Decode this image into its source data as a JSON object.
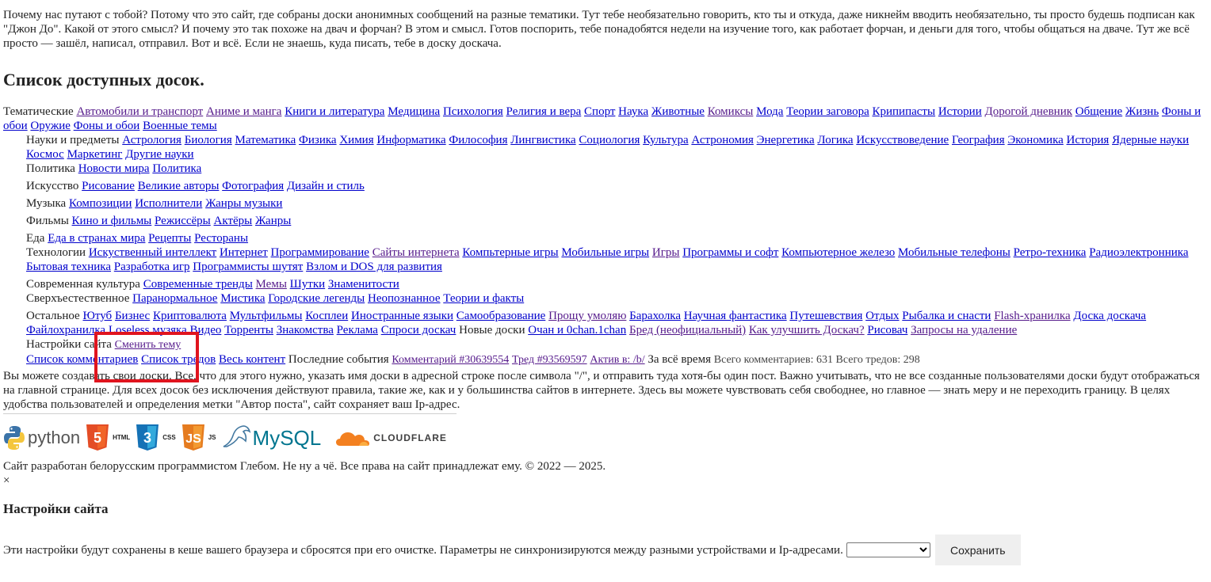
{
  "intro": "Почему нас путают с тобой? Потому что это сайт, где собраны доски анонимных сообщений на разные тематики. Тут тебе необязательно говорить, кто ты и откуда, даже никнейм вводить необязательно, ты просто будешь подписан как \"Джон До\". Какой от этого смысл? И почему это так похоже на двач и форчан? В этом и смысл. Готов поспорить, тебе понадобятся недели на изучение того, как работает форчан, и деньги для того, чтобы общаться на дваче. Тут же всё просто — зашёл, написал, отправил. Вот и всё. Если не знаешь, куда писать, тебе в доску доскача.",
  "boards_title": "Список доступных досок.",
  "categories": {
    "thematic": {
      "label": "Тематические",
      "links": [
        "Автомобили и транспорт",
        "Аниме и манга",
        "Книги и литература",
        "Медицина",
        "Психология",
        "Религия и вера",
        "Спорт",
        "Наука",
        "Животные",
        "Комиксы",
        "Мода",
        "Теории заговора",
        "Крипипасты",
        "Истории",
        "Дорогой дневник",
        "Общение",
        "Жизнь",
        "Фоны и обои",
        "Оружие",
        "Фоны и обои",
        "Военные темы"
      ]
    },
    "science": {
      "label": "Науки и предметы",
      "links": [
        "Астрология",
        "Биология",
        "Математика",
        "Физика",
        "Химия",
        "Информатика",
        "Философия",
        "Лингвистика",
        "Социология",
        "Культура",
        "Астрономия",
        "Энергетика",
        "Логика",
        "Искусствоведение",
        "География",
        "Экономика",
        "История",
        "Ядерные науки",
        "Космос",
        "Маркетинг",
        "Другие науки"
      ]
    },
    "politics": {
      "label": "Политика",
      "links": [
        "Новости мира",
        "Политика"
      ]
    },
    "art": {
      "label": "Искусство",
      "links": [
        "Рисование",
        "Великие авторы",
        "Фотография",
        "Дизайн и стиль"
      ]
    },
    "music": {
      "label": "Музыка",
      "links": [
        "Композиции",
        "Исполнители",
        "Жанры музыки"
      ]
    },
    "films": {
      "label": "Фильмы",
      "links": [
        "Кино и фильмы",
        "Режиссёры",
        "Актёры",
        "Жанры"
      ]
    },
    "food": {
      "label": "Еда",
      "links": [
        "Еда в странах мира",
        "Рецепты",
        "Рестораны"
      ]
    },
    "tech": {
      "label": "Технологии",
      "links": [
        "Искуственный интеллект",
        "Интернет",
        "Программирование",
        "Сайты интернета",
        "Компьтерные игры",
        "Мобильные игры",
        "Игры",
        "Программы и софт",
        "Компьютерное железо",
        "Мобильные телефоны",
        "Ретро-техника",
        "Радиоэлектронника",
        "Бытовая техника",
        "Разработка игр",
        "Программисты шутят",
        "Взлом и DOS для развития"
      ]
    },
    "culture": {
      "label": "Современная культура",
      "links": [
        "Современные тренды",
        "Мемы",
        "Шутки",
        "Знаменитости"
      ]
    },
    "supernatural": {
      "label": "Сверхъестественное",
      "links": [
        "Паранормальное",
        "Мистика",
        "Городские легенды",
        "Неопознанное",
        "Теории и факты"
      ]
    },
    "other": {
      "label": "Остальное",
      "links": [
        "Ютуб",
        "Бизнес",
        "Криптовалюта",
        "Мультфильмы",
        "Косплеи",
        "Иностранные языки",
        "Самообразование",
        "Прощу умоляю",
        "Барахолка",
        "Научная фантастика",
        "Путешевствия",
        "Отдых",
        "Рыбалка и снасти",
        "Flash-хранилка",
        "Доска доскача",
        "Файлохранилка",
        "Loseless музяка",
        "Видео",
        "Торренты",
        "Знакомства",
        "Реклама",
        "Спроси доскач"
      ]
    },
    "new_boards": {
      "label": "Новые доски",
      "links": [
        "Очан и 0chan.1chan",
        "Бред (неофициальный)",
        "Как улучшить Доскач?",
        "Рисовач",
        "Запросы на удаление"
      ]
    },
    "site_settings": {
      "label": "Настройки сайта",
      "link": "Сменить тему"
    },
    "content": {
      "links": [
        "Список комментариев",
        "Список тредов",
        "Весь контент"
      ]
    },
    "recent": {
      "label": "Последние события",
      "comment": "Комментарий #30639554",
      "thread": "Тред #93569597",
      "active": "Актив в: /b/",
      "all_time": "За всё время",
      "stats": "Всего комментариев: 631 Всего тредов: 298"
    }
  },
  "notice": "Вы можете создавать свои доски. Все, что для этого нужно, указать имя доски в адресной строке после символа \"/\", и отправить туда хотя-бы один пост. Важно учитывать, что не все созданные пользователями доски будут отображаться на главной странице. Для всех досок без исключения действуют правила, такие же, как и у большинства сайтов в интернете. Здесь вы можете чувствовать себя свободнее, но главное — знать меру и не переходить границу. В целях удобства пользователей и определения метки \"Автор поста\", сайт сохраняет ваш Ip-адрес.",
  "logos": {
    "python": "python",
    "html": "HTML",
    "css": "CSS",
    "js": "JS",
    "mysql": "MySQL",
    "cloudflare": "CLOUDFLARE"
  },
  "footer": "Сайт разработан белорусским программистом Глебом. Не ну а чё. Все права на сайт принадлежат ему. © 2022 — 2025.",
  "close_symbol": "×",
  "settings": {
    "title": "Настройки сайта",
    "description": "Эти настройки будут сохранены в кеше вашего браузера и сбросятся при его очистке. Параметры не синхронизируются между разными устройствами и Ip-адресами.",
    "select_value": "",
    "save_label": "Сохранить"
  },
  "colors": {
    "link": "#0000cc",
    "visited": "#551a8b",
    "highlight": "#e0141e"
  }
}
